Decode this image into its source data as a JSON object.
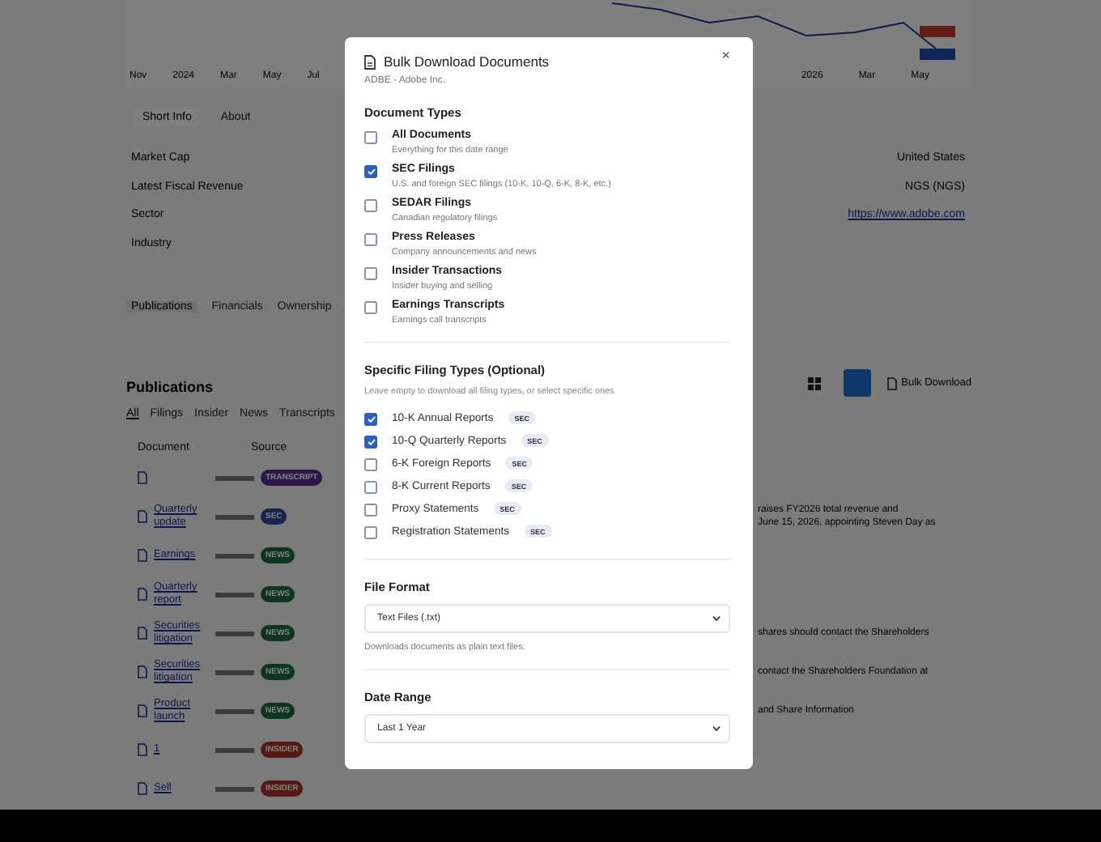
{
  "background": {
    "chart": {
      "left_labels": [
        "Nov",
        "2024",
        "Mar",
        "May",
        "Jul"
      ],
      "right_labels": [
        "2026",
        "Mar",
        "May"
      ]
    },
    "info_tabs": [
      {
        "label": "Short Info",
        "selected": true
      },
      {
        "label": "About",
        "selected": false
      }
    ],
    "info_rows": [
      {
        "label": "Market Cap",
        "value": "United States",
        "kind": "text"
      },
      {
        "label": "Latest Fiscal Revenue",
        "value": "NGS (NGS)",
        "kind": "text"
      },
      {
        "label": "Sector",
        "value": "https://www.adobe.com",
        "kind": "link"
      },
      {
        "label": "Industry"
      }
    ],
    "section_tabs": [
      {
        "label": "Publications",
        "selected": true
      },
      {
        "label": "Financials",
        "selected": false
      },
      {
        "label": "Ownership",
        "selected": false
      }
    ],
    "publications": {
      "title": "Publications",
      "bulk_download": "Bulk Download",
      "filters": [
        {
          "label": "All",
          "selected": true
        },
        {
          "label": "Filings",
          "selected": false
        },
        {
          "label": "Insider",
          "selected": false
        },
        {
          "label": "News",
          "selected": false
        },
        {
          "label": "Transcripts",
          "selected": false
        }
      ],
      "columns": [
        "Document",
        "Source"
      ],
      "rows": [
        {
          "document": "",
          "badge": "TRANSCRIPT",
          "kind": "transcript",
          "snippet": []
        },
        {
          "document": "Quarterly update",
          "badge": "SEC",
          "kind": "sec",
          "snippet": [
            "raises FY2026 total revenue and",
            "June 15, 2026, appointing Steven Day as"
          ]
        },
        {
          "document": "Earnings",
          "badge": "NEWS",
          "kind": "news",
          "snippet": []
        },
        {
          "document": "Quarterly report",
          "badge": "NEWS",
          "kind": "news",
          "snippet": []
        },
        {
          "document": "Securities litigation",
          "badge": "NEWS",
          "kind": "news",
          "snippet": [
            "shares should contact the Shareholders"
          ]
        },
        {
          "document": "Securities litigation",
          "badge": "NEWS",
          "kind": "news",
          "snippet": [
            "contact the Shareholders Foundation at"
          ]
        },
        {
          "document": "Product launch",
          "badge": "NEWS",
          "kind": "news",
          "snippet": [
            "and Share Information"
          ]
        },
        {
          "document": "1",
          "badge": "INSIDER",
          "kind": "insider",
          "snippet": []
        },
        {
          "document": "Sell",
          "badge": "INSIDER",
          "kind": "insider",
          "snippet": []
        }
      ]
    }
  },
  "modal": {
    "title": "Bulk Download Documents",
    "subtitle": "ADBE - Adobe Inc.",
    "close": "×",
    "document_types": {
      "heading": "Document Types",
      "items": [
        {
          "label": "All Documents",
          "description": "Everything for this date range",
          "checked": false
        },
        {
          "label": "SEC Filings",
          "description": "U.S. and foreign SEC filings (10-K, 10-Q, 6-K, 8-K, etc.)",
          "checked": true
        },
        {
          "label": "SEDAR Filings",
          "description": "Canadian regulatory filings",
          "checked": false
        },
        {
          "label": "Press Releases",
          "description": "Company announcements and news",
          "checked": false
        },
        {
          "label": "Insider Transactions",
          "description": "Insider buying and selling",
          "checked": false
        },
        {
          "label": "Earnings Transcripts",
          "description": "Earnings call transcripts",
          "checked": false
        }
      ]
    },
    "filing_types": {
      "heading": "Specific Filing Types (Optional)",
      "hint": "Leave empty to download all filing types, or select specific ones",
      "items": [
        {
          "label": "10-K Annual Reports",
          "tag": "SEC",
          "checked": true
        },
        {
          "label": "10-Q Quarterly Reports",
          "tag": "SEC",
          "checked": true
        },
        {
          "label": "6-K Foreign Reports",
          "tag": "SEC",
          "checked": false
        },
        {
          "label": "8-K Current Reports",
          "tag": "SEC",
          "checked": false
        },
        {
          "label": "Proxy Statements",
          "tag": "SEC",
          "checked": false
        },
        {
          "label": "Registration Statements",
          "tag": "SEC",
          "checked": false
        }
      ]
    },
    "file_format": {
      "heading": "File Format",
      "value": "Text Files (.txt)",
      "help": "Downloads documents as plain text files."
    },
    "date_range": {
      "heading": "Date Range",
      "value": "Last 1 Year"
    }
  }
}
